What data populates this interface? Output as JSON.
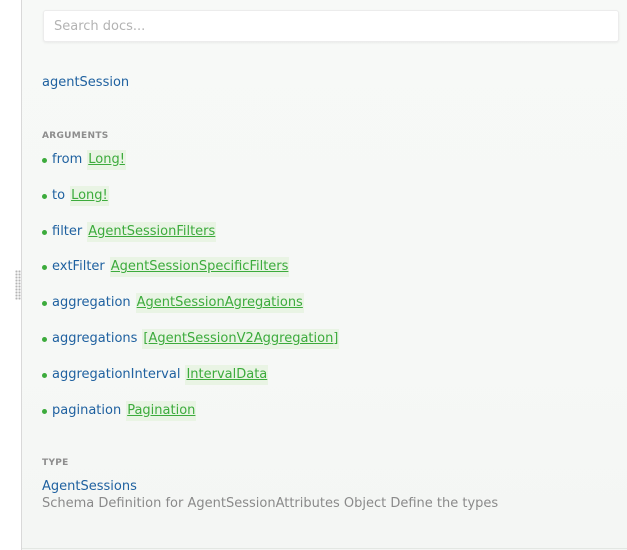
{
  "search": {
    "placeholder": "Search docs..."
  },
  "field": {
    "name": "agentSession"
  },
  "arguments": {
    "title": "ARGUMENTS",
    "items": [
      {
        "name": "from",
        "type": "Long!"
      },
      {
        "name": "to",
        "type": "Long!"
      },
      {
        "name": "filter",
        "type": "AgentSessionFilters"
      },
      {
        "name": "extFilter",
        "type": "AgentSessionSpecificFilters"
      },
      {
        "name": "aggregation",
        "type": "AgentSessionAgregations"
      },
      {
        "name": "aggregations",
        "type": "[AgentSessionV2Aggregation]"
      },
      {
        "name": "aggregationInterval",
        "type": "IntervalData"
      },
      {
        "name": "pagination",
        "type": "Pagination"
      }
    ]
  },
  "type_section": {
    "title": "TYPE",
    "name": "AgentSessions",
    "description": "Schema Definition for AgentSessionAttributes Object Define the types"
  },
  "colors": {
    "field_blue": "#1f61a0",
    "type_green": "#3cab3c",
    "section_gray": "#8d8d8d"
  }
}
